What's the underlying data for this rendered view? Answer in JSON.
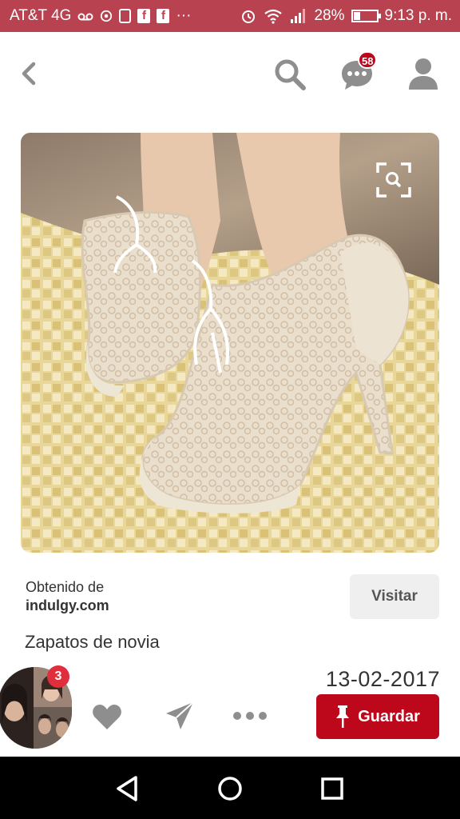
{
  "status_bar": {
    "carrier": "AT&T 4G",
    "battery": "28%",
    "time": "9:13 p. m.",
    "battery_level": 0.28,
    "icons": [
      "voicemail-icon",
      "location-icon",
      "sim-icon",
      "facebook-icon",
      "facebook-icon",
      "more-dots-icon",
      "alarm-icon",
      "wifi-icon",
      "signal-icon",
      "battery-icon"
    ]
  },
  "header": {
    "icons": [
      "back-arrow-icon",
      "search-icon",
      "message-icon",
      "profile-icon"
    ],
    "notification_count": "58"
  },
  "pin": {
    "image_description_icon": "visual-search-icon",
    "source_label": "Obtenido de",
    "source_domain": "indulgy.com",
    "visit_label": "Visitar",
    "title": "Zapatos de novia",
    "date": "13-02-2017"
  },
  "actions": {
    "avatar_badge": "3",
    "save_label": "Guardar",
    "icons": [
      "heart-icon",
      "send-icon",
      "more-icon",
      "pin-icon"
    ]
  },
  "nav_bar": {
    "icons": [
      "back-triangle-icon",
      "home-circle-icon",
      "recents-square-icon"
    ]
  },
  "colors": {
    "status_bar": "#b8424f",
    "brand_red": "#bd081c",
    "icon_gray": "#8e8e8e",
    "visit_bg": "#efefef"
  }
}
